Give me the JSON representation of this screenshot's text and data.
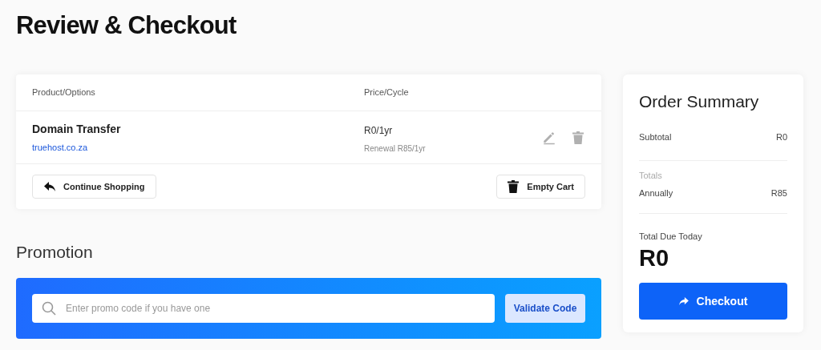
{
  "title": "Review & Checkout",
  "cart": {
    "columns": [
      "Product/Options",
      "Price/Cycle"
    ],
    "items": [
      {
        "name": "Domain Transfer",
        "domain": "truehost.co.za",
        "price": "R0/1yr",
        "renewal": "Renewal R85/1yr"
      }
    ],
    "continue_button": "Continue Shopping",
    "empty_button": "Empty Cart"
  },
  "promotion": {
    "heading": "Promotion",
    "placeholder": "Enter promo code if you have one",
    "button": "Validate Code"
  },
  "summary": {
    "title": "Order Summary",
    "subtotal_label": "Subtotal",
    "subtotal": "R0",
    "totals_label": "Totals",
    "period_label": "Annually",
    "period_total": "R85",
    "due_label": "Total Due Today",
    "due": "R0",
    "checkout_button": "Checkout"
  }
}
